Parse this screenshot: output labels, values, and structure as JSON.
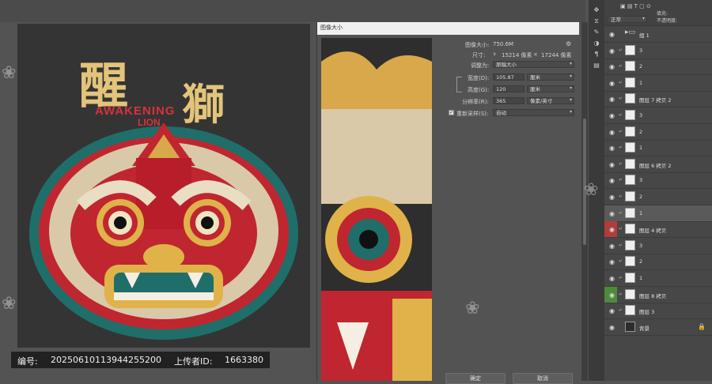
{
  "artwork": {
    "title_cn": "醒",
    "title_cn_2": "獅",
    "title_en_line1": "AWAKENING",
    "title_en_line2": "LION"
  },
  "dialog": {
    "title": "图像大小",
    "image_size_label": "图像大小:",
    "image_size_value": "750.6M",
    "dimensions_label": "尺寸:",
    "dimensions_width": "15214 像素",
    "dimensions_x": "×",
    "dimensions_height": "17244 像素",
    "fit_label": "调整为:",
    "fit_value": "原稿大小",
    "width_label": "宽度(D):",
    "width_value": "105.87",
    "width_unit": "厘米",
    "height_label": "高度(G):",
    "height_value": "120",
    "height_unit": "厘米",
    "resolution_label": "分辨率(R):",
    "resolution_value": "365",
    "resolution_unit": "像素/英寸",
    "resample_label": "重新采样(S):",
    "resample_value": "自动",
    "ok_label": "确定",
    "cancel_label": "取消"
  },
  "layers_panel": {
    "header_blend": "正常",
    "header_opacity": "不透明度:",
    "header_fill": "填充:",
    "rows": [
      {
        "name": "组 1",
        "type": "group"
      },
      {
        "name": "3",
        "type": "layer"
      },
      {
        "name": "2",
        "type": "layer"
      },
      {
        "name": "1",
        "type": "layer"
      },
      {
        "name": "图层 7 拷贝 2",
        "type": "layer"
      },
      {
        "name": "3",
        "type": "layer"
      },
      {
        "name": "2",
        "type": "layer"
      },
      {
        "name": "1",
        "type": "layer"
      },
      {
        "name": "图层 6 拷贝 2",
        "type": "layer"
      },
      {
        "name": "3",
        "type": "layer"
      },
      {
        "name": "2",
        "type": "layer"
      },
      {
        "name": "1",
        "type": "layer"
      },
      {
        "name": "图层 4 拷贝",
        "type": "layer"
      },
      {
        "name": "3",
        "type": "layer"
      },
      {
        "name": "2",
        "type": "layer"
      },
      {
        "name": "1",
        "type": "layer"
      },
      {
        "name": "图层 8 拷贝",
        "type": "layer"
      },
      {
        "name": "图层 3",
        "type": "layer"
      },
      {
        "name": "背景",
        "type": "background"
      }
    ]
  },
  "watermark": {
    "id_label": "编号:",
    "id_value": "20250610113944255200",
    "uploader_label": "上传者ID:",
    "uploader_value": "1663380"
  },
  "colors": {
    "accent_gold": "#e3c47a",
    "accent_red": "#d6323a",
    "teal": "#1f6e6a"
  }
}
